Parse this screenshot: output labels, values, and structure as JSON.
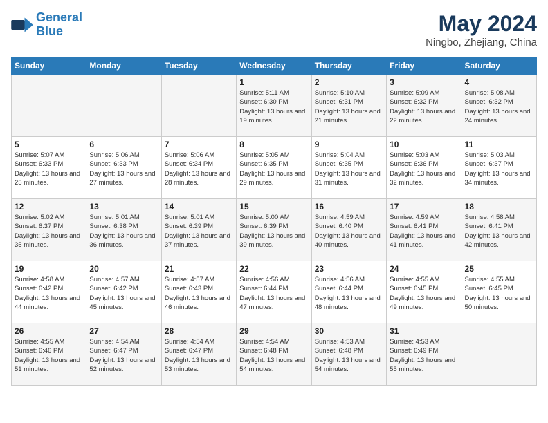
{
  "logo": {
    "line1": "General",
    "line2": "Blue"
  },
  "title": {
    "month_year": "May 2024",
    "location": "Ningbo, Zhejiang, China"
  },
  "weekdays": [
    "Sunday",
    "Monday",
    "Tuesday",
    "Wednesday",
    "Thursday",
    "Friday",
    "Saturday"
  ],
  "weeks": [
    [
      {
        "day": "",
        "sunrise": "",
        "sunset": "",
        "daylight": ""
      },
      {
        "day": "",
        "sunrise": "",
        "sunset": "",
        "daylight": ""
      },
      {
        "day": "",
        "sunrise": "",
        "sunset": "",
        "daylight": ""
      },
      {
        "day": "1",
        "sunrise": "Sunrise: 5:11 AM",
        "sunset": "Sunset: 6:30 PM",
        "daylight": "Daylight: 13 hours and 19 minutes."
      },
      {
        "day": "2",
        "sunrise": "Sunrise: 5:10 AM",
        "sunset": "Sunset: 6:31 PM",
        "daylight": "Daylight: 13 hours and 21 minutes."
      },
      {
        "day": "3",
        "sunrise": "Sunrise: 5:09 AM",
        "sunset": "Sunset: 6:32 PM",
        "daylight": "Daylight: 13 hours and 22 minutes."
      },
      {
        "day": "4",
        "sunrise": "Sunrise: 5:08 AM",
        "sunset": "Sunset: 6:32 PM",
        "daylight": "Daylight: 13 hours and 24 minutes."
      }
    ],
    [
      {
        "day": "5",
        "sunrise": "Sunrise: 5:07 AM",
        "sunset": "Sunset: 6:33 PM",
        "daylight": "Daylight: 13 hours and 25 minutes."
      },
      {
        "day": "6",
        "sunrise": "Sunrise: 5:06 AM",
        "sunset": "Sunset: 6:33 PM",
        "daylight": "Daylight: 13 hours and 27 minutes."
      },
      {
        "day": "7",
        "sunrise": "Sunrise: 5:06 AM",
        "sunset": "Sunset: 6:34 PM",
        "daylight": "Daylight: 13 hours and 28 minutes."
      },
      {
        "day": "8",
        "sunrise": "Sunrise: 5:05 AM",
        "sunset": "Sunset: 6:35 PM",
        "daylight": "Daylight: 13 hours and 29 minutes."
      },
      {
        "day": "9",
        "sunrise": "Sunrise: 5:04 AM",
        "sunset": "Sunset: 6:35 PM",
        "daylight": "Daylight: 13 hours and 31 minutes."
      },
      {
        "day": "10",
        "sunrise": "Sunrise: 5:03 AM",
        "sunset": "Sunset: 6:36 PM",
        "daylight": "Daylight: 13 hours and 32 minutes."
      },
      {
        "day": "11",
        "sunrise": "Sunrise: 5:03 AM",
        "sunset": "Sunset: 6:37 PM",
        "daylight": "Daylight: 13 hours and 34 minutes."
      }
    ],
    [
      {
        "day": "12",
        "sunrise": "Sunrise: 5:02 AM",
        "sunset": "Sunset: 6:37 PM",
        "daylight": "Daylight: 13 hours and 35 minutes."
      },
      {
        "day": "13",
        "sunrise": "Sunrise: 5:01 AM",
        "sunset": "Sunset: 6:38 PM",
        "daylight": "Daylight: 13 hours and 36 minutes."
      },
      {
        "day": "14",
        "sunrise": "Sunrise: 5:01 AM",
        "sunset": "Sunset: 6:39 PM",
        "daylight": "Daylight: 13 hours and 37 minutes."
      },
      {
        "day": "15",
        "sunrise": "Sunrise: 5:00 AM",
        "sunset": "Sunset: 6:39 PM",
        "daylight": "Daylight: 13 hours and 39 minutes."
      },
      {
        "day": "16",
        "sunrise": "Sunrise: 4:59 AM",
        "sunset": "Sunset: 6:40 PM",
        "daylight": "Daylight: 13 hours and 40 minutes."
      },
      {
        "day": "17",
        "sunrise": "Sunrise: 4:59 AM",
        "sunset": "Sunset: 6:41 PM",
        "daylight": "Daylight: 13 hours and 41 minutes."
      },
      {
        "day": "18",
        "sunrise": "Sunrise: 4:58 AM",
        "sunset": "Sunset: 6:41 PM",
        "daylight": "Daylight: 13 hours and 42 minutes."
      }
    ],
    [
      {
        "day": "19",
        "sunrise": "Sunrise: 4:58 AM",
        "sunset": "Sunset: 6:42 PM",
        "daylight": "Daylight: 13 hours and 44 minutes."
      },
      {
        "day": "20",
        "sunrise": "Sunrise: 4:57 AM",
        "sunset": "Sunset: 6:42 PM",
        "daylight": "Daylight: 13 hours and 45 minutes."
      },
      {
        "day": "21",
        "sunrise": "Sunrise: 4:57 AM",
        "sunset": "Sunset: 6:43 PM",
        "daylight": "Daylight: 13 hours and 46 minutes."
      },
      {
        "day": "22",
        "sunrise": "Sunrise: 4:56 AM",
        "sunset": "Sunset: 6:44 PM",
        "daylight": "Daylight: 13 hours and 47 minutes."
      },
      {
        "day": "23",
        "sunrise": "Sunrise: 4:56 AM",
        "sunset": "Sunset: 6:44 PM",
        "daylight": "Daylight: 13 hours and 48 minutes."
      },
      {
        "day": "24",
        "sunrise": "Sunrise: 4:55 AM",
        "sunset": "Sunset: 6:45 PM",
        "daylight": "Daylight: 13 hours and 49 minutes."
      },
      {
        "day": "25",
        "sunrise": "Sunrise: 4:55 AM",
        "sunset": "Sunset: 6:45 PM",
        "daylight": "Daylight: 13 hours and 50 minutes."
      }
    ],
    [
      {
        "day": "26",
        "sunrise": "Sunrise: 4:55 AM",
        "sunset": "Sunset: 6:46 PM",
        "daylight": "Daylight: 13 hours and 51 minutes."
      },
      {
        "day": "27",
        "sunrise": "Sunrise: 4:54 AM",
        "sunset": "Sunset: 6:47 PM",
        "daylight": "Daylight: 13 hours and 52 minutes."
      },
      {
        "day": "28",
        "sunrise": "Sunrise: 4:54 AM",
        "sunset": "Sunset: 6:47 PM",
        "daylight": "Daylight: 13 hours and 53 minutes."
      },
      {
        "day": "29",
        "sunrise": "Sunrise: 4:54 AM",
        "sunset": "Sunset: 6:48 PM",
        "daylight": "Daylight: 13 hours and 54 minutes."
      },
      {
        "day": "30",
        "sunrise": "Sunrise: 4:53 AM",
        "sunset": "Sunset: 6:48 PM",
        "daylight": "Daylight: 13 hours and 54 minutes."
      },
      {
        "day": "31",
        "sunrise": "Sunrise: 4:53 AM",
        "sunset": "Sunset: 6:49 PM",
        "daylight": "Daylight: 13 hours and 55 minutes."
      },
      {
        "day": "",
        "sunrise": "",
        "sunset": "",
        "daylight": ""
      }
    ]
  ]
}
